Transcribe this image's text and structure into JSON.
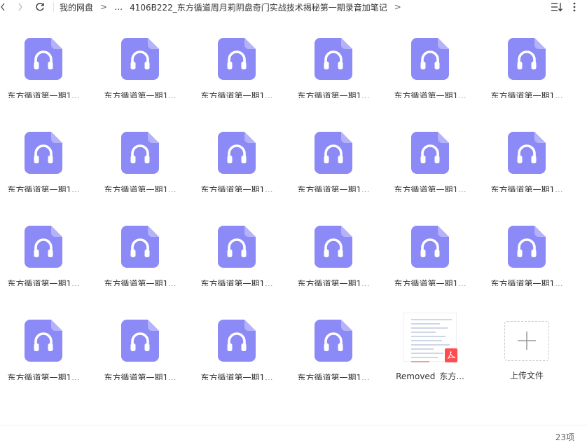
{
  "toolbar": {
    "breadcrumbs": [
      "我的网盘",
      "…",
      "4106B222_东方循道周月莉阴盘奇门实战技术揭秘第一期录音加笔记"
    ],
    "arrow": ">",
    "icons": {
      "back": "chevron-left-icon",
      "forward": "chevron-right-icon",
      "refresh": "refresh-icon",
      "sort": "sort-icon",
      "more": "more-vertical-icon"
    }
  },
  "files": [
    {
      "name": "东方循道第一期1...",
      "type": "audio"
    },
    {
      "name": "东方循道第一期1...",
      "type": "audio"
    },
    {
      "name": "东方循道第一期1...",
      "type": "audio"
    },
    {
      "name": "东方循道第一期1...",
      "type": "audio"
    },
    {
      "name": "东方循道第一期1...",
      "type": "audio"
    },
    {
      "name": "东方循道第一期1...",
      "type": "audio"
    },
    {
      "name": "东方循道第一期1...",
      "type": "audio"
    },
    {
      "name": "东方循道第一期1...",
      "type": "audio"
    },
    {
      "name": "东方循道第一期1...",
      "type": "audio"
    },
    {
      "name": "东方循道第一期1...",
      "type": "audio"
    },
    {
      "name": "东方循道第一期1...",
      "type": "audio"
    },
    {
      "name": "东方循道第一期1...",
      "type": "audio"
    },
    {
      "name": "东方循道第一期1...",
      "type": "audio"
    },
    {
      "name": "东方循道第一期1...",
      "type": "audio"
    },
    {
      "name": "东方循道第一期1...",
      "type": "audio"
    },
    {
      "name": "东方循道第一期1...",
      "type": "audio"
    },
    {
      "name": "东方循道第一期1...",
      "type": "audio"
    },
    {
      "name": "东方循道第一期1...",
      "type": "audio"
    },
    {
      "name": "东方循道第一期1...",
      "type": "audio"
    },
    {
      "name": "东方循道第一期1...",
      "type": "audio"
    },
    {
      "name": "东方循道第一期1...",
      "type": "audio"
    },
    {
      "name": "东方循道第一期1...",
      "type": "audio"
    },
    {
      "name": "Removed_东方...",
      "type": "pdf"
    }
  ],
  "upload": {
    "label": "上传文件",
    "icon": "plus-icon"
  },
  "status": {
    "count": "23项"
  },
  "colors": {
    "audio_icon": "#8b8af6",
    "audio_fold": "#b3b2fa",
    "pdf_badge": "#ff4d4f"
  }
}
